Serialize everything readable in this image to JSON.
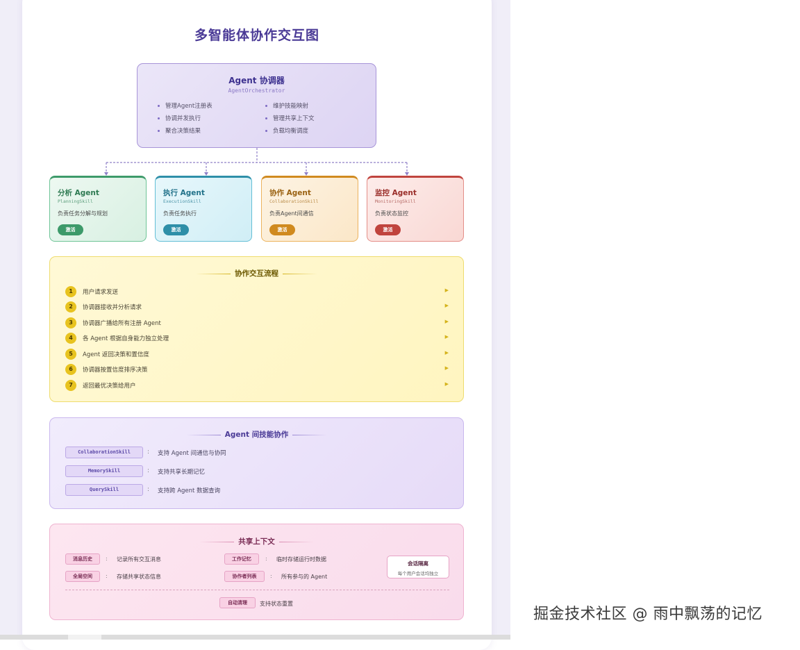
{
  "title": "多智能体协作交互图",
  "orchestrator": {
    "title": "Agent 协调器",
    "subtitle": "AgentOrchestrator",
    "left_items": [
      "管理Agent注册表",
      "协调并发执行",
      "聚合决策结果"
    ],
    "right_items": [
      "维护技能映射",
      "管理共享上下文",
      "负载均衡调度"
    ]
  },
  "agents": [
    {
      "name": "分析 Agent",
      "skill": "PlanningSkill",
      "desc": "负责任务分解与规划",
      "badge": "激活",
      "color": "#3d9a6a"
    },
    {
      "name": "执行 Agent",
      "skill": "ExecutionSkill",
      "desc": "负责任务执行",
      "badge": "激活",
      "color": "#2e8fa8"
    },
    {
      "name": "协作 Agent",
      "skill": "CollaborationSkill",
      "desc": "负责Agent间通信",
      "badge": "激活",
      "color": "#d08a1f"
    },
    {
      "name": "监控 Agent",
      "skill": "MonitoringSkill",
      "desc": "负责状态监控",
      "badge": "激活",
      "color": "#c0443e"
    }
  ],
  "flow": {
    "title": "协作交互流程",
    "steps": [
      {
        "num": "1",
        "text": "用户请求发送"
      },
      {
        "num": "2",
        "text": "协调器接收并分析请求"
      },
      {
        "num": "3",
        "text": "协调器广播给所有注册 Agent"
      },
      {
        "num": "4",
        "text": "各 Agent 根据自身能力独立处理"
      },
      {
        "num": "5",
        "text": "Agent 返回决策和置信度"
      },
      {
        "num": "6",
        "text": "协调器按置信度排序决策"
      },
      {
        "num": "7",
        "text": "返回最优决策给用户"
      }
    ]
  },
  "skills": {
    "title": "Agent 间技能协作",
    "rows": [
      {
        "name": "CollaborationSkill",
        "desc": "支持 Agent 间通信与协同"
      },
      {
        "name": "MemorySkill",
        "desc": "支持共享长期记忆"
      },
      {
        "name": "QuerySkill",
        "desc": "支持跨 Agent 数据查询"
      }
    ]
  },
  "context": {
    "title": "共享上下文",
    "items": [
      {
        "label": "消息历史",
        "desc": "记录所有交互消息"
      },
      {
        "label": "全局空间",
        "desc": "存储共享状态信息"
      },
      {
        "label": "工作记忆",
        "desc": "临时存储运行时数据"
      },
      {
        "label": "协作者列表",
        "desc": "所有参与的 Agent"
      }
    ],
    "isolation_title": "会话隔离",
    "isolation_desc": "每个用户会话均独立",
    "cleanup_label": "自动清理",
    "cleanup_desc": "支持状态重置"
  },
  "watermark": "掘金技术社区 @ 雨中飘荡的记忆"
}
